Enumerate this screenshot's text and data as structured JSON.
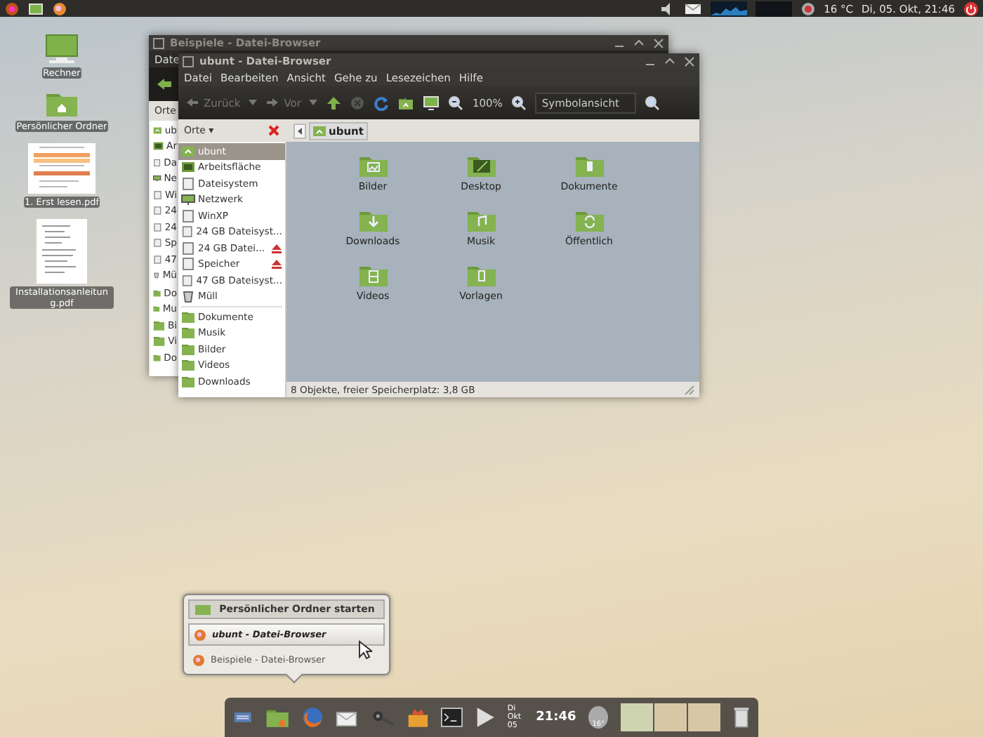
{
  "top_panel": {
    "temperature": "16 °C",
    "clock": "Di, 05. Okt, 21:46"
  },
  "desktop_icons": [
    {
      "label": "Rechner",
      "kind": "computer"
    },
    {
      "label": "Persönlicher Ordner",
      "kind": "home"
    },
    {
      "label": "1. Erst lesen.pdf",
      "kind": "pdf"
    },
    {
      "label": "Installationsanleitung.pdf",
      "kind": "document"
    }
  ],
  "back_window": {
    "title": "Beispiele - Datei-Browser",
    "menu": [
      "Date"
    ],
    "sidebar_header": "Orte",
    "sidebar_items": [
      {
        "label": "ub",
        "kind": "home"
      },
      {
        "label": "Ar",
        "kind": "desktop"
      },
      {
        "label": "Da",
        "kind": "drive"
      },
      {
        "label": "Ne",
        "kind": "network"
      },
      {
        "label": "Wi",
        "kind": "drive"
      },
      {
        "label": "24",
        "kind": "drive"
      },
      {
        "label": "24",
        "kind": "drive"
      },
      {
        "label": "Sp",
        "kind": "drive"
      },
      {
        "label": "47",
        "kind": "drive"
      },
      {
        "label": "Mü",
        "kind": "trash"
      },
      {
        "label": "Do",
        "kind": "folder"
      },
      {
        "label": "Mu",
        "kind": "folder"
      },
      {
        "label": "Bi",
        "kind": "folder"
      },
      {
        "label": "Vi",
        "kind": "folder"
      },
      {
        "label": "Do",
        "kind": "folder"
      }
    ]
  },
  "window": {
    "title": "ubunt - Datei-Browser",
    "menu": [
      "Datei",
      "Bearbeiten",
      "Ansicht",
      "Gehe zu",
      "Lesezeichen",
      "Hilfe"
    ],
    "toolbar": {
      "back": "Zurück",
      "forward": "Vor",
      "zoom": "100%",
      "view": "Symbolansicht"
    },
    "path": "ubunt",
    "sidebar": {
      "header": "Orte ▾",
      "places": [
        {
          "label": "ubunt",
          "kind": "home",
          "selected": true,
          "eject": false
        },
        {
          "label": "Arbeitsfläche",
          "kind": "desktop",
          "selected": false,
          "eject": false
        },
        {
          "label": "Dateisystem",
          "kind": "drive",
          "selected": false,
          "eject": false
        },
        {
          "label": "Netzwerk",
          "kind": "network",
          "selected": false,
          "eject": false
        },
        {
          "label": "WinXP",
          "kind": "drive",
          "selected": false,
          "eject": false
        },
        {
          "label": "24 GB Dateisyst...",
          "kind": "drive",
          "selected": false,
          "eject": false
        },
        {
          "label": "24 GB Datei...",
          "kind": "drive",
          "selected": false,
          "eject": true
        },
        {
          "label": "Speicher",
          "kind": "drive",
          "selected": false,
          "eject": true
        },
        {
          "label": "47 GB Dateisyst...",
          "kind": "drive",
          "selected": false,
          "eject": false
        },
        {
          "label": "Müll",
          "kind": "trash",
          "selected": false,
          "eject": false
        }
      ],
      "bookmarks": [
        {
          "label": "Dokumente",
          "selected": false
        },
        {
          "label": "Musik",
          "selected": false
        },
        {
          "label": "Bilder",
          "selected": false
        },
        {
          "label": "Videos",
          "selected": false
        },
        {
          "label": "Downloads",
          "selected": false
        }
      ]
    },
    "items": [
      {
        "label": "Bilder",
        "kind": "pictures"
      },
      {
        "label": "Desktop",
        "kind": "desktop"
      },
      {
        "label": "Dokumente",
        "kind": "documents"
      },
      {
        "label": "Downloads",
        "kind": "downloads"
      },
      {
        "label": "Musik",
        "kind": "music"
      },
      {
        "label": "Öffentlich",
        "kind": "public"
      },
      {
        "label": "Videos",
        "kind": "videos"
      },
      {
        "label": "Vorlagen",
        "kind": "templates"
      }
    ],
    "status": "8 Objekte, freier Speicherplatz: 3,8 GB"
  },
  "popup": {
    "header": "Persönlicher Ordner starten",
    "windows": [
      {
        "label": "ubunt - Datei-Browser",
        "selected": true
      },
      {
        "label": "Beispiele - Datei-Browser",
        "selected": false
      }
    ]
  },
  "dock": {
    "day": "Di",
    "date": "Okt 05",
    "time": "21:46",
    "weather": "16°"
  }
}
